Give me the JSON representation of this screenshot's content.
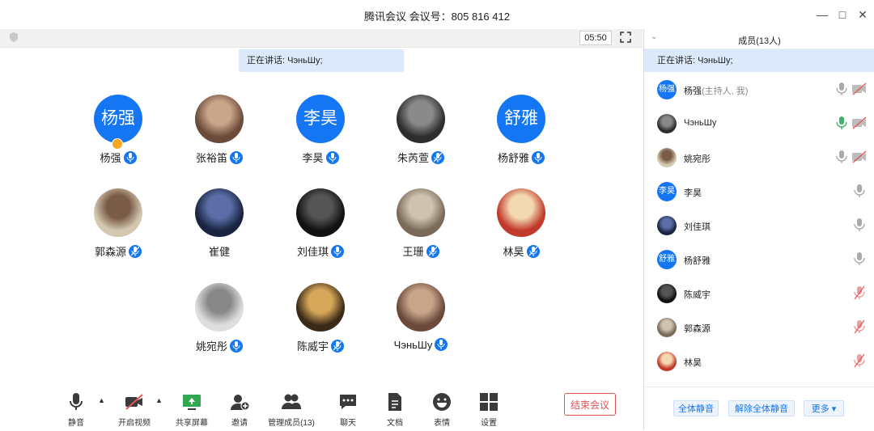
{
  "window": {
    "title": "腾讯会议 会议号：805 816 412"
  },
  "main": {
    "timer": "05:50",
    "speaking": "正在讲话: ЧэньШу;",
    "participants": [
      {
        "name": "杨强",
        "avatar_text": "杨强",
        "mic": "on",
        "host": true
      },
      {
        "name": "张裕笛",
        "avatar_text": "",
        "mic": "on"
      },
      {
        "name": "李昊",
        "avatar_text": "李昊",
        "mic": "on"
      },
      {
        "name": "朱芮萱",
        "avatar_text": "",
        "mic": "muted"
      },
      {
        "name": "杨舒雅",
        "avatar_text": "舒雅",
        "mic": "on"
      },
      {
        "name": "郭森源",
        "avatar_text": "",
        "mic": "muted"
      },
      {
        "name": "崔健",
        "avatar_text": "",
        "mic": "none"
      },
      {
        "name": "刘佳琪",
        "avatar_text": "",
        "mic": "on"
      },
      {
        "name": "王珊",
        "avatar_text": "",
        "mic": "muted"
      },
      {
        "name": "林昊",
        "avatar_text": "",
        "mic": "muted"
      },
      {
        "name": "姚宛彤",
        "avatar_text": "",
        "mic": "on"
      },
      {
        "name": "陈威宇",
        "avatar_text": "",
        "mic": "muted"
      },
      {
        "name": "ЧэньШу",
        "avatar_text": "",
        "mic": "on"
      }
    ]
  },
  "toolbar": {
    "mute": "静音",
    "video": "开启视频",
    "share": "共享屏幕",
    "invite": "邀请",
    "manage": "管理成员(13)",
    "chat": "聊天",
    "docs": "文档",
    "emoji": "表情",
    "settings": "设置",
    "end": "结束会议"
  },
  "panel": {
    "title": "成员(13人)",
    "speaking": "正在讲话: ЧэньШу;",
    "members": [
      {
        "name": "杨强",
        "note": "(主持人, 我)",
        "avatar_text": "杨强",
        "mic": "gray",
        "cam": "off"
      },
      {
        "name": "ЧэньШу",
        "note": "",
        "avatar_text": "",
        "mic": "green",
        "cam": "off"
      },
      {
        "name": "姚宛彤",
        "note": "",
        "avatar_text": "",
        "mic": "gray",
        "cam": "off"
      },
      {
        "name": "李昊",
        "note": "",
        "avatar_text": "李昊",
        "mic": "gray",
        "cam": "none"
      },
      {
        "name": "刘佳琪",
        "note": "",
        "avatar_text": "",
        "mic": "gray",
        "cam": "none"
      },
      {
        "name": "杨舒雅",
        "note": "",
        "avatar_text": "舒雅",
        "mic": "gray",
        "cam": "none"
      },
      {
        "name": "陈威宇",
        "note": "",
        "avatar_text": "",
        "mic": "muted",
        "cam": "none"
      },
      {
        "name": "郭森源",
        "note": "",
        "avatar_text": "",
        "mic": "muted",
        "cam": "none"
      },
      {
        "name": "林昊",
        "note": "",
        "avatar_text": "",
        "mic": "muted",
        "cam": "none"
      }
    ],
    "mute_all": "全体静音",
    "unmute_all": "解除全体静音",
    "more": "更多"
  },
  "colors": {
    "accent": "#1476f2",
    "danger": "#e55353",
    "highlight": "#dbe9fb"
  }
}
